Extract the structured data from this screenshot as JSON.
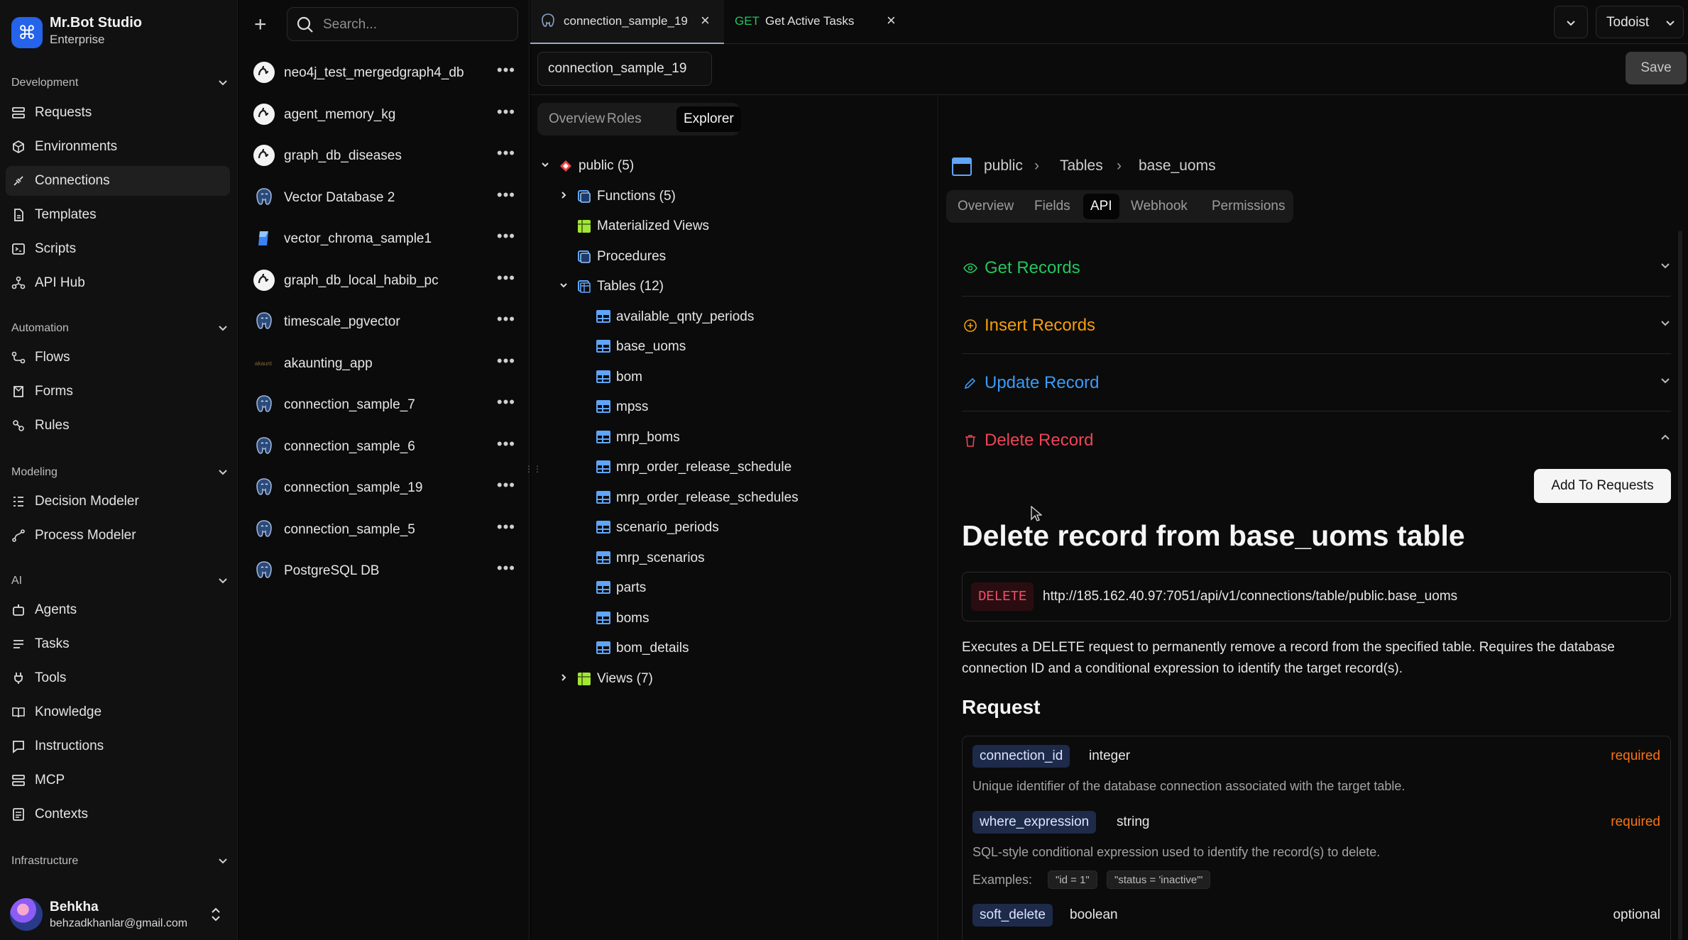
{
  "brand": {
    "name": "Mr.Bot Studio",
    "plan": "Enterprise",
    "logo_glyph": "⌘"
  },
  "sidebar": {
    "sections": [
      {
        "title": "Development",
        "items": [
          {
            "label": "Requests",
            "icon": "requests-icon"
          },
          {
            "label": "Environments",
            "icon": "environments-icon"
          },
          {
            "label": "Connections",
            "icon": "connections-icon",
            "active": true
          },
          {
            "label": "Templates",
            "icon": "templates-icon"
          },
          {
            "label": "Scripts",
            "icon": "scripts-icon"
          },
          {
            "label": "API Hub",
            "icon": "api-hub-icon"
          }
        ]
      },
      {
        "title": "Automation",
        "items": [
          {
            "label": "Flows",
            "icon": "flows-icon"
          },
          {
            "label": "Forms",
            "icon": "forms-icon"
          },
          {
            "label": "Rules",
            "icon": "rules-icon"
          }
        ]
      },
      {
        "title": "Modeling",
        "items": [
          {
            "label": "Decision Modeler",
            "icon": "decision-modeler-icon"
          },
          {
            "label": "Process Modeler",
            "icon": "process-modeler-icon"
          }
        ]
      },
      {
        "title": "AI",
        "items": [
          {
            "label": "Agents",
            "icon": "agents-icon"
          },
          {
            "label": "Tasks",
            "icon": "tasks-icon"
          },
          {
            "label": "Tools",
            "icon": "tools-icon"
          },
          {
            "label": "Knowledge",
            "icon": "knowledge-icon"
          },
          {
            "label": "Instructions",
            "icon": "instructions-icon"
          },
          {
            "label": "MCP",
            "icon": "mcp-icon"
          },
          {
            "label": "Contexts",
            "icon": "contexts-icon"
          }
        ]
      },
      {
        "title": "Infrastructure",
        "items": []
      }
    ],
    "user": {
      "name": "Behkha",
      "email": "behzadkhanlar@gmail.com"
    }
  },
  "connections": {
    "search_placeholder": "Search...",
    "items": [
      {
        "name": "neo4j_test_mergedgraph4_db",
        "type": "neo4j"
      },
      {
        "name": "agent_memory_kg",
        "type": "neo4j"
      },
      {
        "name": "graph_db_diseases",
        "type": "neo4j"
      },
      {
        "name": "Vector Database 2",
        "type": "postgres"
      },
      {
        "name": "vector_chroma_sample1",
        "type": "chroma"
      },
      {
        "name": "graph_db_local_habib_pc",
        "type": "neo4j"
      },
      {
        "name": "timescale_pgvector",
        "type": "postgres"
      },
      {
        "name": "akaunting_app",
        "type": "mysql"
      },
      {
        "name": "connection_sample_7",
        "type": "postgres"
      },
      {
        "name": "connection_sample_6",
        "type": "postgres"
      },
      {
        "name": "connection_sample_19",
        "type": "postgres"
      },
      {
        "name": "connection_sample_5",
        "type": "postgres"
      },
      {
        "name": "PostgreSQL DB",
        "type": "postgres"
      }
    ],
    "more_glyph": "•••"
  },
  "tabs": [
    {
      "label": "connection_sample_19",
      "active": true
    },
    {
      "method": "GET",
      "label": "Get Active Tasks"
    }
  ],
  "workspace": "Todoist",
  "connection": {
    "name_value": "connection_sample_19",
    "save_label": "Save",
    "view_tabs": [
      "Overview",
      "Roles",
      "Explorer"
    ],
    "active_view": "Explorer"
  },
  "tree": {
    "schema": "public (5)",
    "functions": "Functions (5)",
    "materialized_views": "Materialized Views",
    "procedures": "Procedures",
    "tables": "Tables (12)",
    "table_items": [
      "available_qnty_periods",
      "base_uoms",
      "bom",
      "mpss",
      "mrp_boms",
      "mrp_order_release_schedule",
      "mrp_order_release_schedules",
      "scenario_periods",
      "mrp_scenarios",
      "parts",
      "boms",
      "bom_details"
    ],
    "views": "Views (7)"
  },
  "detail": {
    "breadcrumb": [
      "public",
      "Tables",
      "base_uoms"
    ],
    "tabs": [
      "Overview",
      "Fields",
      "API",
      "Webhook",
      "Permissions"
    ],
    "active_tab": "API",
    "sections": [
      {
        "label": "Get Records",
        "color": "#22c55e"
      },
      {
        "label": "Insert Records",
        "color": "#f59e0b"
      },
      {
        "label": "Update Record",
        "color": "#3b9bf5"
      },
      {
        "label": "Delete Record",
        "color": "#ef4455"
      }
    ],
    "add_button": "Add To Requests",
    "heading": "Delete record from base_uoms table",
    "method": "DELETE",
    "url": "http://185.162.40.97:7051/api/v1/connections/table/public.base_uoms",
    "description": "Executes a DELETE request to permanently remove a record from the specified table. Requires the database connection ID and a conditional expression to identify the target record(s).",
    "request_title": "Request",
    "params": [
      {
        "name": "connection_id",
        "type": "integer",
        "req": "required",
        "desc": "Unique identifier of the database connection associated with the target table."
      },
      {
        "name": "where_expression",
        "type": "string",
        "req": "required",
        "desc": "SQL-style conditional expression used to identify the record(s) to delete."
      },
      {
        "name": "soft_delete",
        "type": "boolean",
        "req": "optional",
        "desc": ""
      }
    ],
    "examples_label": "Examples:",
    "examples": [
      "\"id = 1\"",
      "\"status = 'inactive'\""
    ]
  }
}
